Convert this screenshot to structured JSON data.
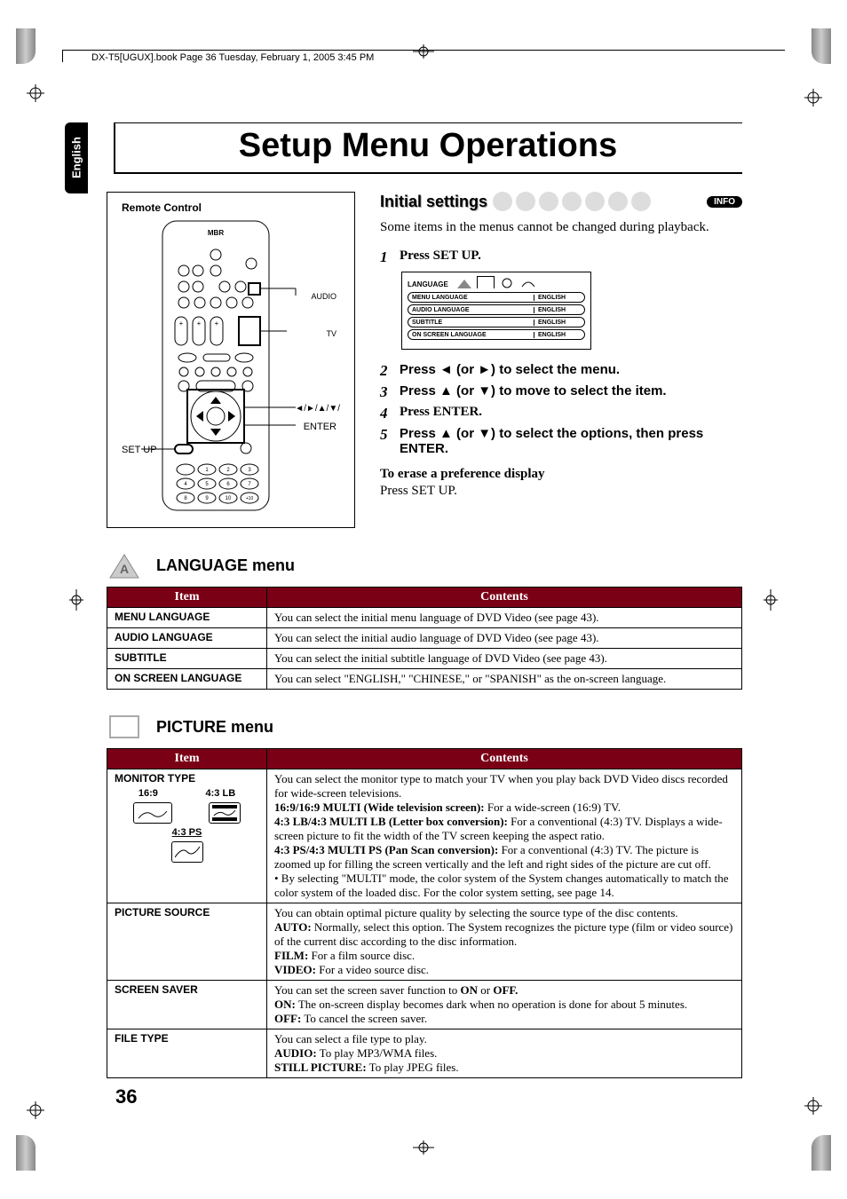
{
  "header": {
    "book_info": "DX-T5[UGUX].book  Page 36  Tuesday, February 1, 2005  3:45 PM"
  },
  "lang_tab": "English",
  "title": "Setup Menu Operations",
  "remote": {
    "box_title": "Remote Control",
    "brand": "MBR",
    "label_audio": "AUDIO",
    "label_tv": "TV",
    "label_arrows": "◄/►/▲/▼/",
    "label_enter": "ENTER",
    "label_setup": "SET UP"
  },
  "initial": {
    "heading": "Initial settings",
    "info_badge": "INFO",
    "intro": "Some items in the menus cannot be changed during playback.",
    "osd": {
      "tab": "LANGUAGE",
      "rows": [
        {
          "item": "MENU LANGUAGE",
          "val": "ENGLISH"
        },
        {
          "item": "AUDIO LANGUAGE",
          "val": "ENGLISH"
        },
        {
          "item": "SUBTITLE",
          "val": "ENGLISH"
        },
        {
          "item": "ON SCREEN LANGUAGE",
          "val": "ENGLISH"
        }
      ]
    },
    "steps": {
      "s1": "Press SET UP.",
      "s2": "Press ◄ (or ►) to select the menu.",
      "s3": "Press ▲ (or ▼) to move to select the item.",
      "s4": "Press ENTER.",
      "s5": "Press ▲ (or ▼) to select the options, then press ENTER."
    },
    "erase_title": "To erase a preference display",
    "erase_body": "Press SET UP."
  },
  "lang_menu": {
    "title": "LANGUAGE menu",
    "headers": {
      "item": "Item",
      "contents": "Contents"
    },
    "rows": [
      {
        "item": "MENU LANGUAGE",
        "contents": "You can select the initial menu language of DVD Video (see page 43)."
      },
      {
        "item": "AUDIO LANGUAGE",
        "contents": "You can select the initial audio language of DVD Video (see page 43)."
      },
      {
        "item": "SUBTITLE",
        "contents": "You can select the initial subtitle language of DVD Video (see page 43)."
      },
      {
        "item": "ON SCREEN LANGUAGE",
        "contents": "You can select \"ENGLISH,\" \"CHINESE,\" or \"SPANISH\" as the on-screen language."
      }
    ]
  },
  "pic_menu": {
    "title": "PICTURE menu",
    "headers": {
      "item": "Item",
      "contents": "Contents"
    },
    "monitor": {
      "item": "MONITOR TYPE",
      "labels": {
        "a": "16:9",
        "b": "4:3 LB",
        "c": "4:3 PS"
      },
      "intro": "You can select the monitor type to match your TV when you play back DVD Video discs recorded for wide-screen televisions.",
      "l1a": "16:9/16:9 MULTI (Wide television screen):",
      "l1b": " For a wide-screen (16:9) TV.",
      "l2a": "4:3 LB/4:3 MULTI LB (Letter box conversion):",
      "l2b": " For a conventional (4:3) TV. Displays a wide-screen picture to fit the width of the TV screen keeping the aspect ratio.",
      "l3a": "4:3 PS/4:3 MULTI PS (Pan Scan conversion):",
      "l3b": " For a conventional (4:3) TV. The picture is zoomed up for filling the screen vertically and the left and right sides of the picture are cut off.",
      "l4": "• By selecting \"MULTI\" mode, the color system of the System changes automatically to match the color system of the loaded disc. For the color system setting, see page 14."
    },
    "picsource": {
      "item": "PICTURE SOURCE",
      "intro": "You can obtain optimal picture quality by selecting the source type of the disc contents.",
      "auto_a": "AUTO:",
      "auto_b": " Normally, select this option. The System recognizes the picture type (film or video source) of the current disc according to the disc information.",
      "film_a": "FILM:",
      "film_b": " For a film source disc.",
      "video_a": "VIDEO:",
      "video_b": " For a video source disc."
    },
    "screensaver": {
      "item": "SCREEN SAVER",
      "intro_a": "You can set the screen saver function to ",
      "intro_b": "ON",
      "intro_c": " or ",
      "intro_d": "OFF.",
      "on_a": "ON:",
      "on_b": " The on-screen display becomes dark when no operation is done for about 5 minutes.",
      "off_a": "OFF:",
      "off_b": " To cancel the screen saver."
    },
    "filetype": {
      "item": "FILE TYPE",
      "intro": "You can select a file type to play.",
      "audio_a": "AUDIO:",
      "audio_b": " To play MP3/WMA files.",
      "still_a": "STILL PICTURE:",
      "still_b": " To play JPEG files."
    }
  },
  "page_num": "36"
}
